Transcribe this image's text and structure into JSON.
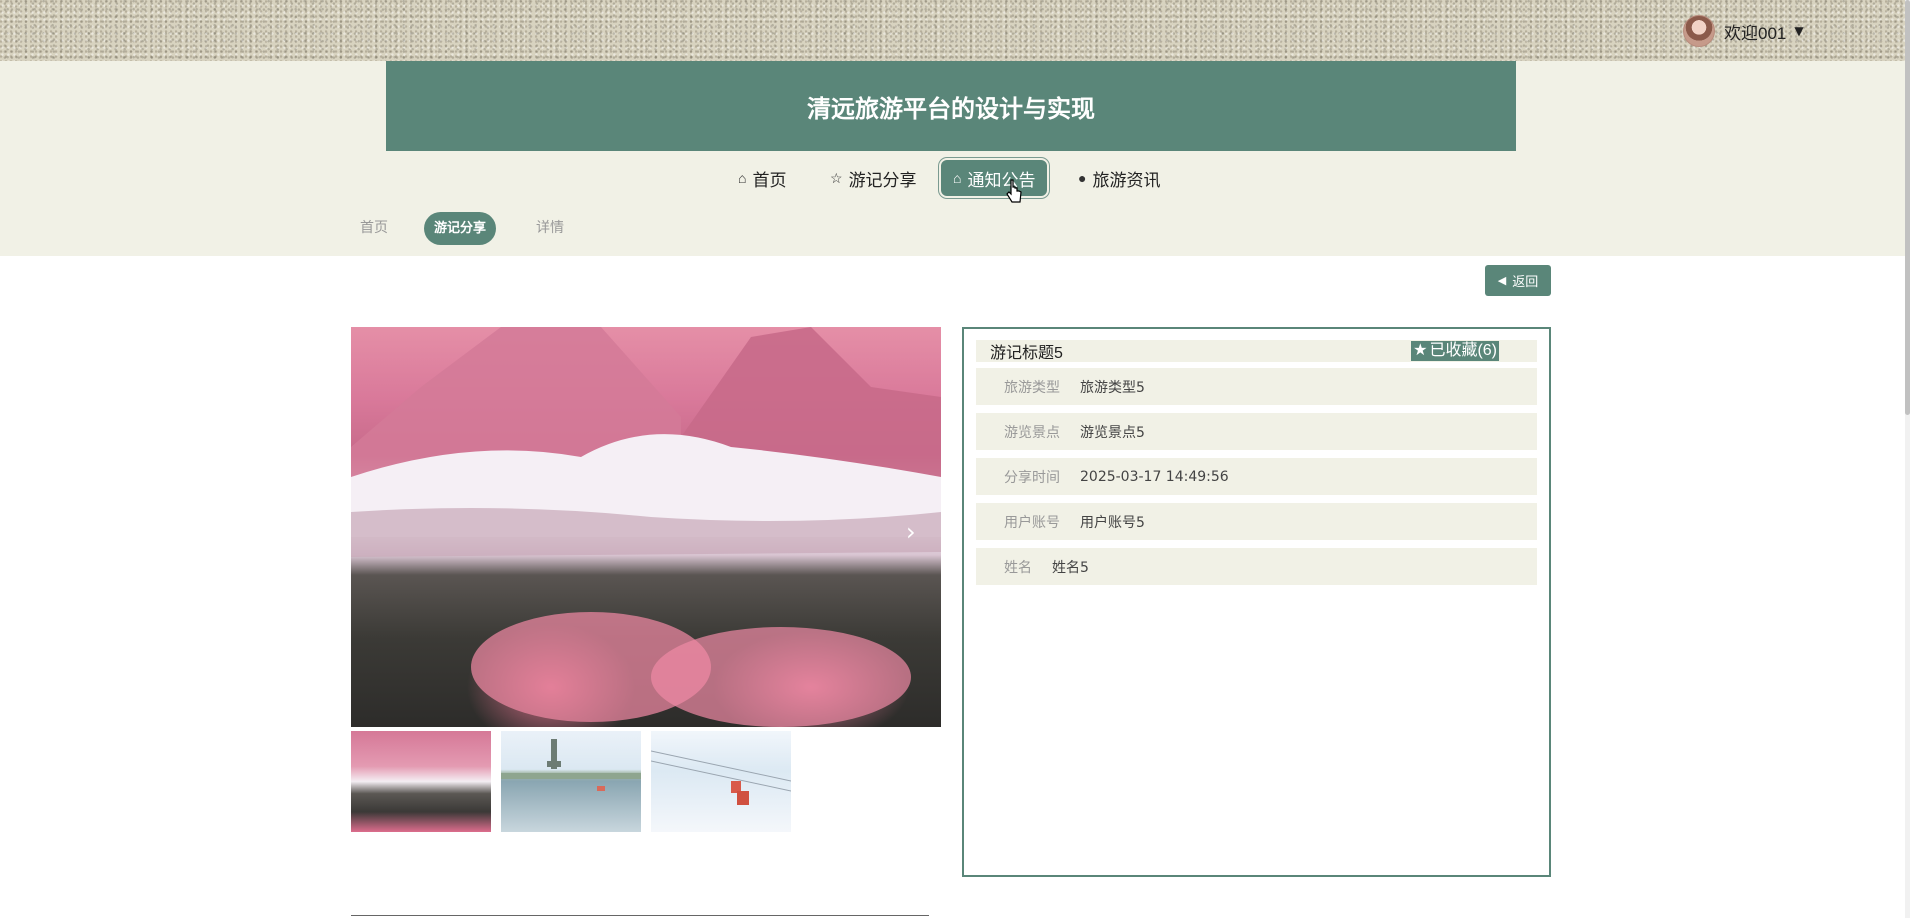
{
  "header": {
    "title": "清远旅游平台的设计与实现",
    "welcome": "欢迎001"
  },
  "nav": {
    "items": [
      {
        "label": "首页",
        "icon": "home-icon"
      },
      {
        "label": "游记分享",
        "icon": "star-icon"
      },
      {
        "label": "通知公告",
        "icon": "bag-icon",
        "active": true
      },
      {
        "label": "旅游资讯",
        "icon": "info-icon"
      }
    ]
  },
  "breadcrumb": {
    "items": [
      "首页",
      "游记分享",
      "详情"
    ],
    "active_index": 1
  },
  "back_label": "返回",
  "detail": {
    "title": "游记标题5",
    "favorite_label": "已收藏(6)",
    "fields": [
      {
        "label": "旅游类型",
        "value": "旅游类型5"
      },
      {
        "label": "游览景点",
        "value": "游览景点5"
      },
      {
        "label": "分享时间",
        "value": "2025-03-17 14:49:56"
      },
      {
        "label": "用户账号",
        "value": "用户账号5"
      },
      {
        "label": "姓名",
        "value": "姓名5"
      }
    ]
  },
  "colors": {
    "accent": "#5a8679",
    "band": "#f1f1e6"
  }
}
